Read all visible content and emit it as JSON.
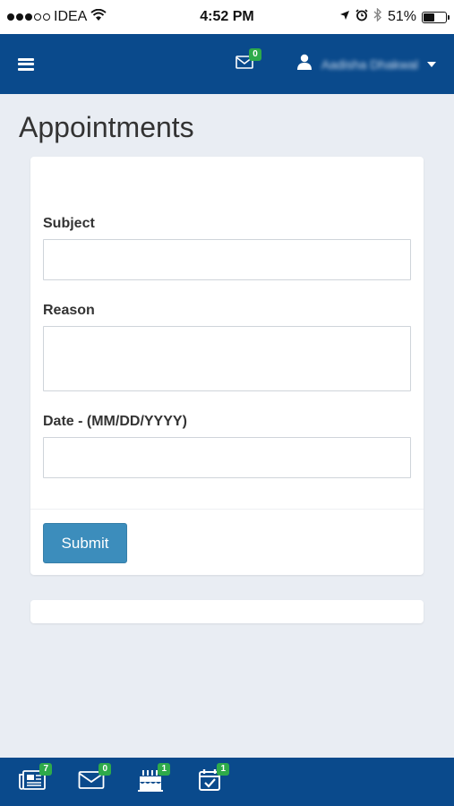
{
  "status_bar": {
    "carrier": "IDEA",
    "time": "4:52 PM",
    "battery_percent": "51%",
    "battery_level": 0.51
  },
  "navbar": {
    "mail_badge": "0",
    "user_name": "Aadisha Dhakwal"
  },
  "page": {
    "title": "Appointments"
  },
  "form": {
    "subject_label": "Subject",
    "subject_value": "",
    "reason_label": "Reason",
    "reason_value": "",
    "date_label": "Date - (MM/DD/YYYY)",
    "date_value": "",
    "submit_label": "Submit"
  },
  "bottom_tabs": [
    {
      "icon": "news-icon",
      "badge": "7"
    },
    {
      "icon": "mail-icon",
      "badge": "0"
    },
    {
      "icon": "birthday-cake-icon",
      "badge": "1"
    },
    {
      "icon": "calendar-check-icon",
      "badge": "1"
    }
  ],
  "colors": {
    "navbar": "#0a4a8c",
    "badge": "#2eaa4a",
    "button": "#3c8dbc",
    "background": "#e9edf3"
  }
}
